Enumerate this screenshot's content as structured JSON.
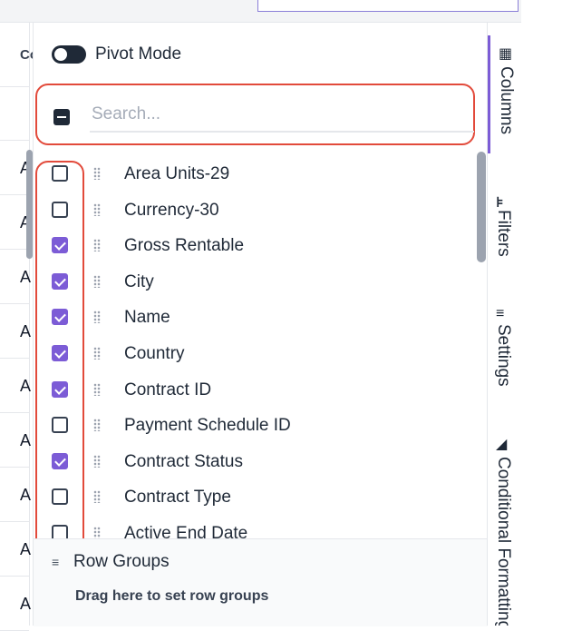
{
  "grid": {
    "header_text": "Co",
    "row_text": "A"
  },
  "pivot": {
    "label": "Pivot Mode",
    "enabled": false
  },
  "search": {
    "placeholder": "Search..."
  },
  "columns": [
    {
      "label": "Area Units-29",
      "checked": false
    },
    {
      "label": "Currency-30",
      "checked": false
    },
    {
      "label": "Gross Rentable",
      "checked": true
    },
    {
      "label": "City",
      "checked": true
    },
    {
      "label": "Name",
      "checked": true
    },
    {
      "label": "Country",
      "checked": true
    },
    {
      "label": "Contract ID",
      "checked": true
    },
    {
      "label": "Payment Schedule ID",
      "checked": false
    },
    {
      "label": "Contract Status",
      "checked": true
    },
    {
      "label": "Contract Type",
      "checked": false
    },
    {
      "label": "Active End Date",
      "checked": false
    }
  ],
  "row_groups": {
    "title": "Row Groups",
    "hint": "Drag here to set row groups",
    "icon": "row-groups-icon"
  },
  "side_tabs": [
    {
      "label": "Columns",
      "icon": "columns-icon",
      "active": true
    },
    {
      "label": "Filters",
      "icon": "filter-icon",
      "active": false
    },
    {
      "label": "Settings",
      "icon": "settings-icon",
      "active": false
    },
    {
      "label": "Conditional Formatting",
      "icon": "paint-bucket-icon",
      "active": false
    }
  ],
  "colors": {
    "accent": "#7c5cd6",
    "highlight": "#e24a3b"
  }
}
